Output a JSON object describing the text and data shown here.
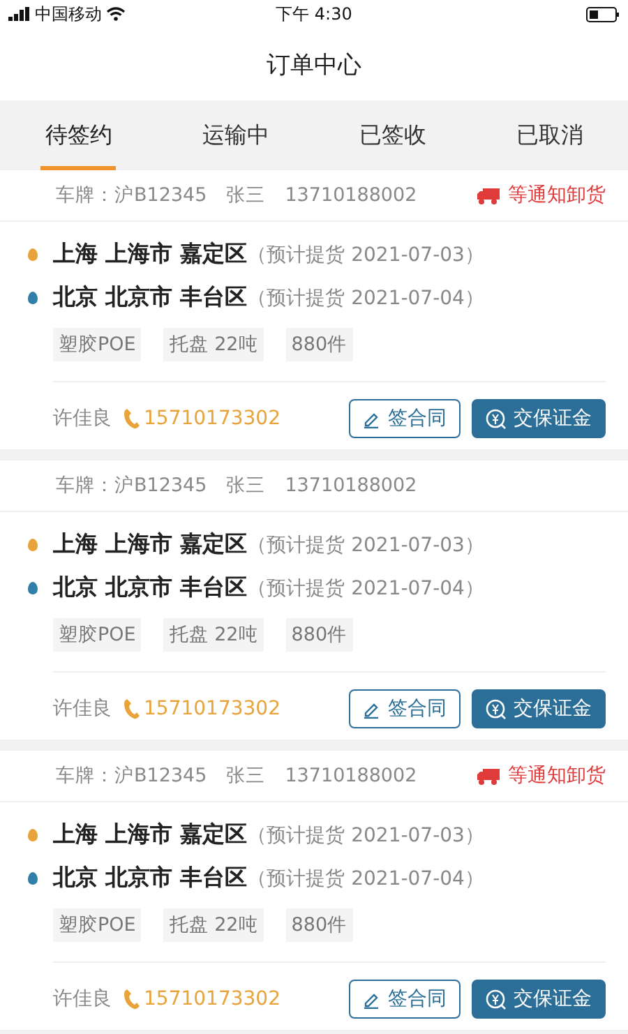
{
  "status_bar": {
    "carrier": "中国移动",
    "time": "下午 4:30"
  },
  "title": "订单中心",
  "tabs": [
    {
      "label": "待签约",
      "selected": true
    },
    {
      "label": "运输中",
      "selected": false
    },
    {
      "label": "已签收",
      "selected": false
    },
    {
      "label": "已取消",
      "selected": false
    }
  ],
  "orders": [
    {
      "plate": "车牌：沪B12345",
      "driver": "张三",
      "driver_phone": "13710188002",
      "status": "等通知卸货",
      "stops": [
        {
          "kind": "origin",
          "place": "上海 上海市 嘉定区",
          "note": "（预计提货  2021-07-03）"
        },
        {
          "kind": "destination",
          "place": "北京 北京市 丰台区",
          "note": "（预计提货  2021-07-04）"
        }
      ],
      "tags": [
        "塑胶POE",
        "托盘 22吨",
        "880件"
      ],
      "contact": "许佳良",
      "contact_phone": "15710173302",
      "actions": [
        {
          "kind": "outline",
          "label": "签合同"
        },
        {
          "kind": "filled",
          "label": "交保证金"
        }
      ]
    },
    {
      "plate": "车牌：沪B12345",
      "driver": "张三",
      "driver_phone": "13710188002",
      "stops": [
        {
          "kind": "origin",
          "place": "上海 上海市 嘉定区",
          "note": "（预计提货  2021-07-03）"
        },
        {
          "kind": "destination",
          "place": "北京 北京市 丰台区",
          "note": "（预计提货  2021-07-04）"
        }
      ],
      "tags": [
        "塑胶POE",
        "托盘 22吨",
        "880件"
      ],
      "contact": "许佳良",
      "contact_phone": "15710173302",
      "actions": [
        {
          "kind": "outline",
          "label": "签合同"
        },
        {
          "kind": "filled",
          "label": "交保证金"
        }
      ]
    },
    {
      "plate": "车牌：沪B12345",
      "driver": "张三",
      "driver_phone": "13710188002",
      "status": "等通知卸货",
      "stops": [
        {
          "kind": "origin",
          "place": "上海 上海市 嘉定区",
          "note": "（预计提货  2021-07-03）"
        },
        {
          "kind": "destination",
          "place": "北京 北京市 丰台区",
          "note": "（预计提货  2021-07-04）"
        }
      ],
      "tags": [
        "塑胶POE",
        "托盘 22吨",
        "880件"
      ],
      "contact": "许佳良",
      "contact_phone": "15710173302",
      "actions": [
        {
          "kind": "outline",
          "label": "签合同"
        },
        {
          "kind": "filled",
          "label": "交保证金"
        }
      ]
    }
  ]
}
